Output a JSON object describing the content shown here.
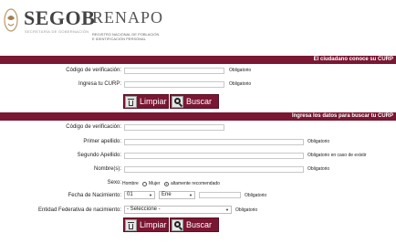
{
  "header": {
    "segob": "SEGOB",
    "segob_sub": "SECRETARÍA DE GOBERNACIÓN",
    "renapo": "RENAPO",
    "renapo_sub1": "REGISTRO NACIONAL DE POBLACIÓN",
    "renapo_sub2": "E IDENTIFICACIÓN PERSONAL"
  },
  "section1": {
    "title": "El ciudadano conoce su CURP",
    "verification_label": "Código de verificación:",
    "verification_note": "Obligatorio",
    "curp_label": "Ingresa tu CURP:",
    "curp_note": "Obligatorio",
    "clear_label": "Limpiar",
    "search_label": "Buscar"
  },
  "section2": {
    "title": "Ingresa los datos para buscar tu CURP",
    "verification_label": "Código de verificación:",
    "first_surname_label": "Primer apellido:",
    "first_surname_note": "Obligatorio",
    "second_surname_label": "Segundo Apellido:",
    "second_surname_note": "Obligatorio en caso de existir",
    "names_label": "Nombre(s):",
    "names_note": "Obligatorio",
    "sex_label": "Sexo:",
    "sex_male": "Hombre",
    "sex_female": "Mujer",
    "sex_note": "altamente recomendado",
    "birth_label": "Fecha de Nacimiento:",
    "birth_day": "01",
    "birth_month": "Ene",
    "birth_note": "Obligatorio",
    "state_label": "Entidad Federativa de nacimiento:",
    "state_value": "- Seleccione -",
    "state_note": "Obligatorio",
    "clear_label": "Limpiar",
    "search_label": "Buscar"
  },
  "colors": {
    "brand": "#7a1733"
  },
  "icons": [
    "eagle-emblem-icon",
    "trash-icon",
    "magnifier-icon",
    "chevron-down-icon"
  ]
}
